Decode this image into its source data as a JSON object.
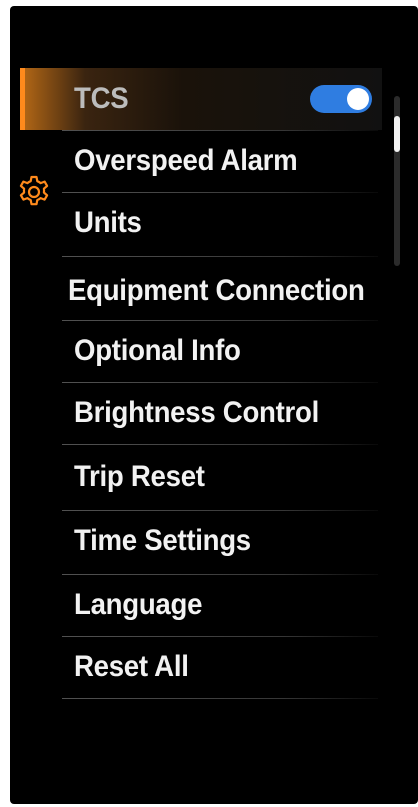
{
  "menu": {
    "items": [
      {
        "label": "TCS",
        "toggle": true
      },
      {
        "label": "Overspeed Alarm"
      },
      {
        "label": "Units"
      },
      {
        "label": "Equipment Connection"
      },
      {
        "label": "Optional Info"
      },
      {
        "label": "Brightness Control"
      },
      {
        "label": "Trip Reset"
      },
      {
        "label": "Time Settings"
      },
      {
        "label": "Language"
      },
      {
        "label": "Reset All"
      }
    ],
    "selected_index": 0,
    "tcs_toggle_on": true
  },
  "icons": {
    "settings": "gear-icon"
  },
  "colors": {
    "background": "#000000",
    "text": "#f2f2f2",
    "accent_orange": "#ff8a1c",
    "toggle_blue": "#2f7de1"
  }
}
